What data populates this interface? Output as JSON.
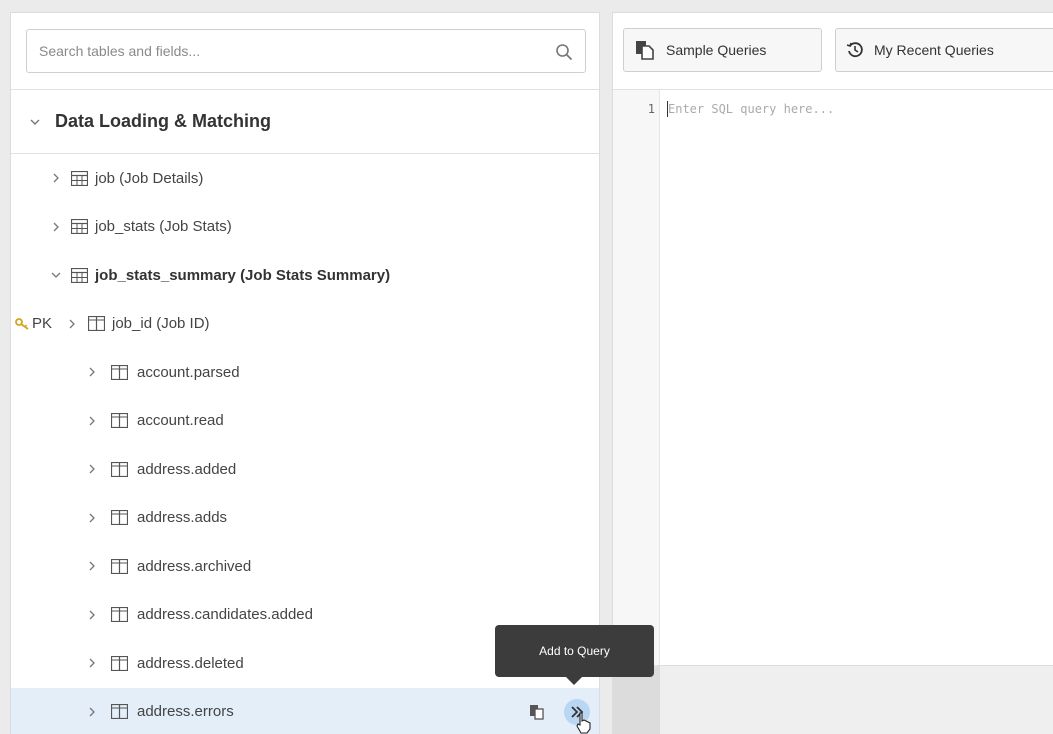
{
  "search": {
    "placeholder": "Search tables and fields..."
  },
  "group": {
    "title": "Data Loading & Matching"
  },
  "tables": [
    {
      "label": "job (Job Details)"
    },
    {
      "label": "job_stats (Job Stats)"
    },
    {
      "label": "job_stats_summary (Job Stats Summary)"
    }
  ],
  "fields": [
    {
      "label": "job_id (Job ID)",
      "pk": "PK"
    },
    {
      "label": "account.parsed"
    },
    {
      "label": "account.read"
    },
    {
      "label": "address.added"
    },
    {
      "label": "address.adds"
    },
    {
      "label": "address.archived"
    },
    {
      "label": "address.candidates.added"
    },
    {
      "label": "address.deleted"
    },
    {
      "label": "address.errors"
    }
  ],
  "toolbar": {
    "sample_queries": "Sample Queries",
    "recent_queries": "My Recent Queries"
  },
  "editor": {
    "line_number": "1",
    "placeholder": "Enter SQL query here..."
  },
  "tooltip": {
    "text": "Add to Query"
  },
  "colors": {
    "pk_key": "#d4a520",
    "selected_row": "#e3eef8",
    "add_button": "#b9d6f2"
  }
}
